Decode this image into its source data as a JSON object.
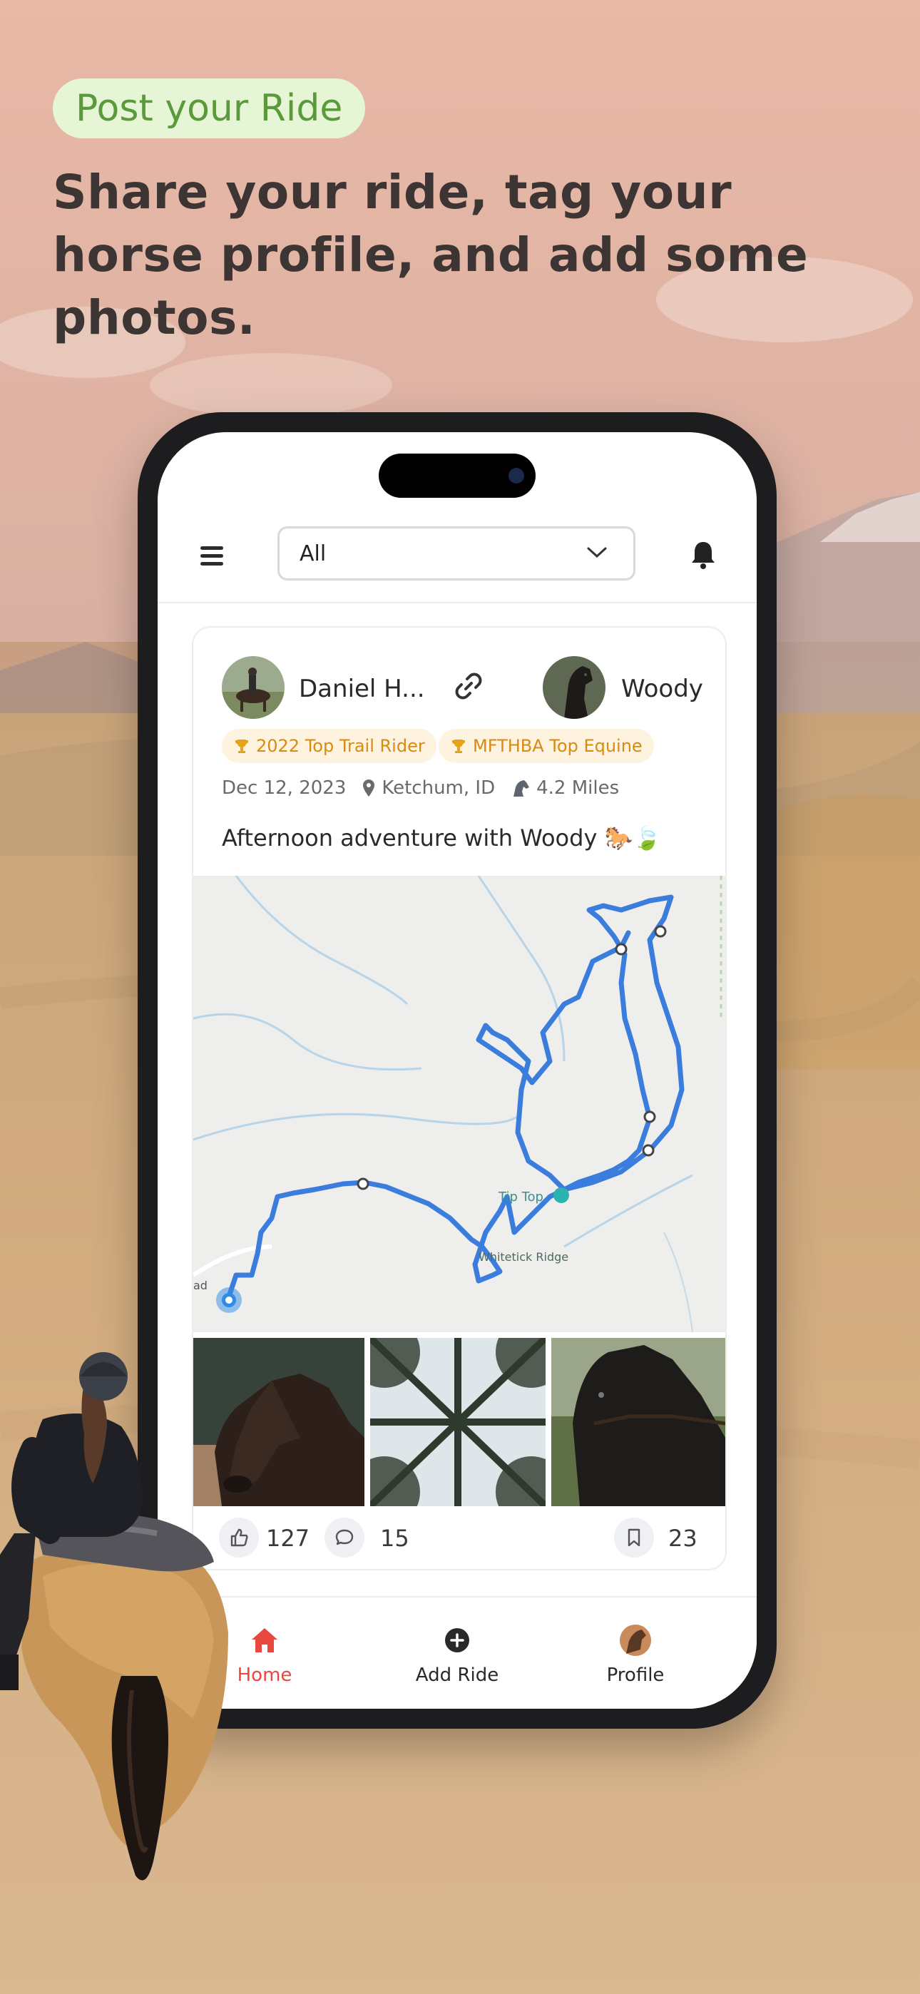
{
  "hero": {
    "tag": "Post your Ride",
    "headline": "Share your ride, tag your horse profile, and add some photos."
  },
  "app": {
    "filter": {
      "selected": "All"
    },
    "post": {
      "rider_name": "Daniel H...",
      "horse_name": "Woody",
      "badges": [
        "2022 Top Trail Rider",
        "MFTHBA Top Equine"
      ],
      "date": "Dec 12, 2023",
      "location": "Ketchum, ID",
      "distance": "4.2 Miles",
      "caption": "Afternoon adventure with Woody 🐎🍃",
      "map_labels": [
        "Tip Top",
        "Whitetick Ridge",
        "ad"
      ],
      "likes": "127",
      "comments": "15",
      "saves": "23"
    },
    "tabs": [
      {
        "label": "Home",
        "active": true
      },
      {
        "label": "Add Ride",
        "active": false
      },
      {
        "label": "Profile",
        "active": false
      }
    ]
  },
  "colors": {
    "accent_red": "#e8483f",
    "badge_text": "#d98a12",
    "tag_green": "#5b9a3b",
    "route_blue": "#3b7ddd"
  }
}
